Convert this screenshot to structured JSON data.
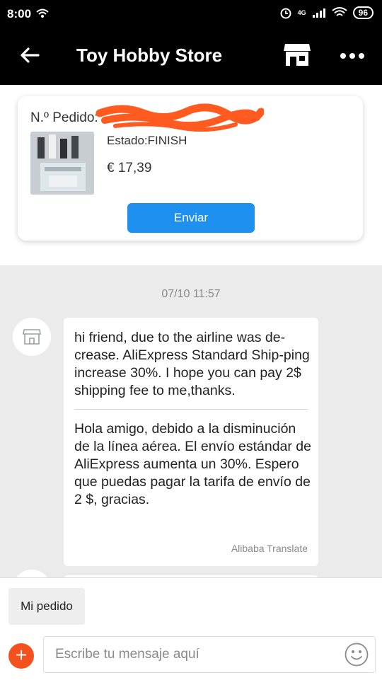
{
  "status_bar": {
    "time": "8:00",
    "network": "4G",
    "battery": "96"
  },
  "header": {
    "title": "Toy Hobby Store"
  },
  "order": {
    "label": "N.º Pedido:",
    "status": "Estado:FINISH",
    "price": "€ 17,39",
    "send_button": "Enviar"
  },
  "chat": {
    "timestamp": "07/10 11:57",
    "message": {
      "original": "hi friend, due to the  airline was de-crease. AliExpress Standard Ship-ping increase 30%. I hope you can pay 2$ shipping fee to me,thanks.",
      "translated": "Hola amigo, debido a la disminución de la línea aérea. El envío estándar de AliExpress aumenta un 30%. Espero que puedas pagar la tarifa de envío de 2 $, gracias.",
      "translator": "Alibaba Translate"
    }
  },
  "bottom": {
    "quick_reply": "Mi pedido",
    "input_placeholder": "Escribe tu mensaje aquí"
  },
  "colors": {
    "header_bg": "#000000",
    "send_button": "#1e90f0",
    "plus_button": "#f4511e",
    "redaction": "#ff5a1f"
  },
  "icons": {
    "back": "arrow-left-icon",
    "store": "store-icon",
    "more": "more-dots-icon",
    "avatar": "shop-avatar-icon",
    "plus": "plus-icon",
    "emoji": "smiley-icon"
  }
}
